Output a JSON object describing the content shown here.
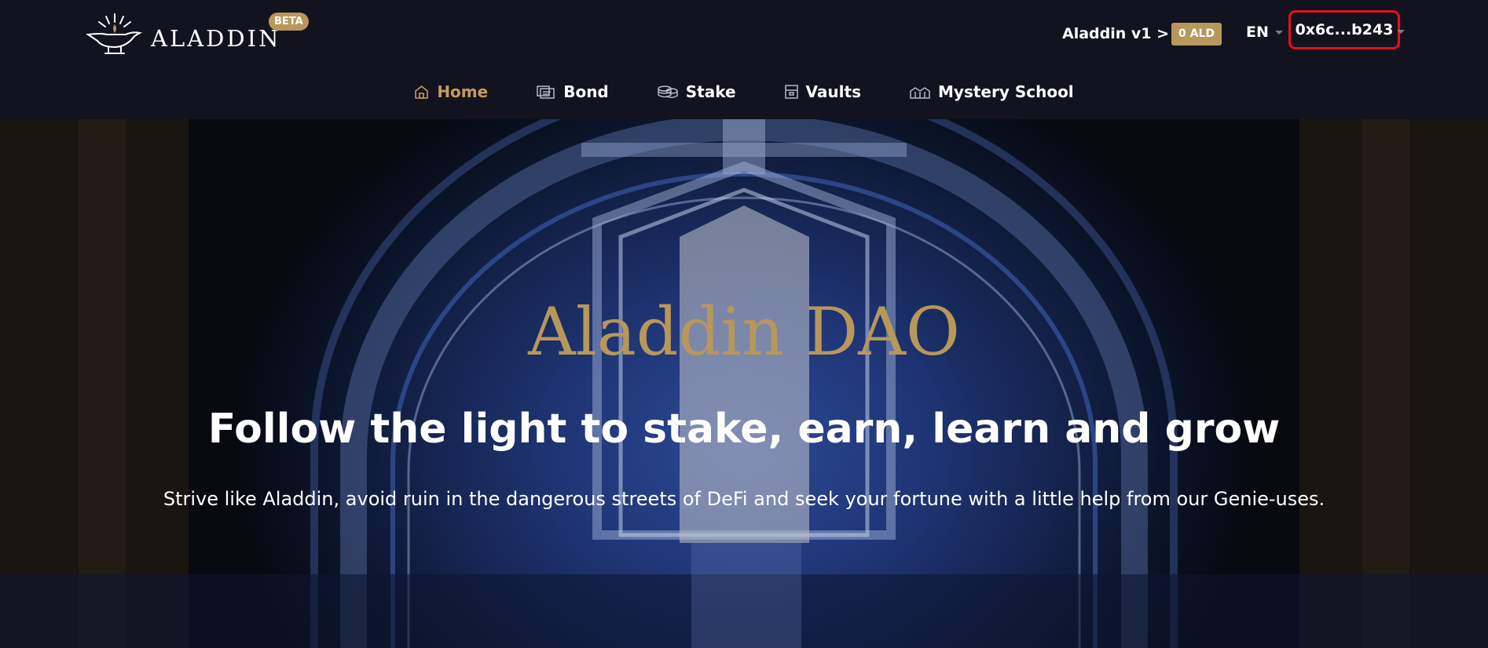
{
  "header": {
    "logo_text": "ALADDIN",
    "beta_label": "BETA",
    "version_link": "Aladdin v1 >",
    "ald_balance": "0 ALD",
    "language": "EN",
    "wallet_address": "0x6c...b243"
  },
  "nav": {
    "items": [
      {
        "label": "Home",
        "icon": "home-icon",
        "active": true
      },
      {
        "label": "Bond",
        "icon": "bond-icon",
        "active": false
      },
      {
        "label": "Stake",
        "icon": "coins-icon",
        "active": false
      },
      {
        "label": "Vaults",
        "icon": "vault-icon",
        "active": false
      },
      {
        "label": "Mystery School",
        "icon": "school-icon",
        "active": false
      }
    ]
  },
  "hero": {
    "title": "Aladdin DAO",
    "subtitle": "Follow the light to stake, earn, learn and grow",
    "description": "Strive like Aladdin, avoid ruin in the dangerous streets of DeFi and seek your fortune with a little help from our Genie-uses."
  },
  "colors": {
    "accent": "#b8975a",
    "nav_active": "#c49b5e",
    "background": "#13131f",
    "wallet_border": "#e5101f"
  }
}
